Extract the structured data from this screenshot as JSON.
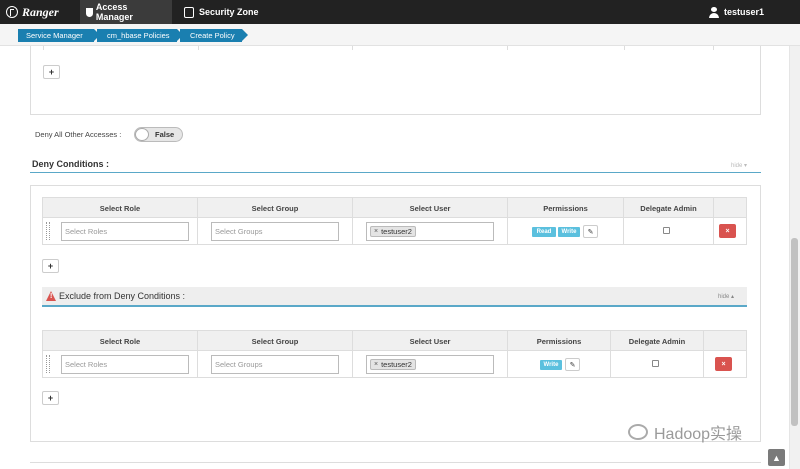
{
  "nav": {
    "brand": "Ranger",
    "access_manager": "Access Manager",
    "security_zone": "Security Zone",
    "user": "testuser1"
  },
  "breadcrumb": [
    "Service Manager",
    "cm_hbase Policies",
    "Create Policy"
  ],
  "deny_all": {
    "label": "Deny All Other Accesses :",
    "value": "False"
  },
  "deny_conditions": {
    "title": "Deny Conditions :",
    "hide": "hide",
    "headers": [
      "Select Role",
      "Select Group",
      "Select User",
      "Permissions",
      "Delegate Admin"
    ],
    "row": {
      "role_placeholder": "Select Roles",
      "group_placeholder": "Select Groups",
      "user_tag": "testuser2",
      "permissions": [
        "Read",
        "Write"
      ]
    }
  },
  "exclude_deny": {
    "title": "Exclude from Deny Conditions :",
    "hide": "hide",
    "headers": [
      "Select Role",
      "Select Group",
      "Select User",
      "Permissions",
      "Delegate Admin"
    ],
    "row": {
      "role_placeholder": "Select Roles",
      "group_placeholder": "Select Groups",
      "user_tag": "testuser2",
      "permissions": [
        "Write"
      ]
    }
  },
  "add_label": "+",
  "remove_label": "×",
  "tag_x": "×",
  "pencil_glyph": "✎",
  "to_top_glyph": "▲",
  "watermark": "Hadoop实操"
}
